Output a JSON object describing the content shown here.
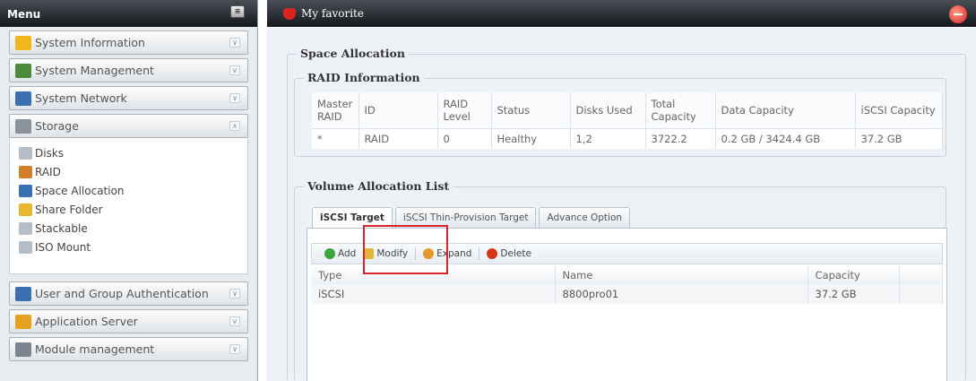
{
  "menu": {
    "title": "Menu",
    "groups_top": [
      {
        "label": "System Information",
        "icon": "info-icon",
        "color": "#f2b51c"
      },
      {
        "label": "System Management",
        "icon": "tools-icon",
        "color": "#4a8a3a"
      },
      {
        "label": "System Network",
        "icon": "network-icon",
        "color": "#3a6fb0"
      },
      {
        "label": "Storage",
        "icon": "storage-icon",
        "color": "#8a939c"
      }
    ],
    "storage_items": [
      {
        "label": "Disks",
        "icon": "disk-icon",
        "color": "#b5bec6"
      },
      {
        "label": "RAID",
        "icon": "raid-icon",
        "color": "#d0802a"
      },
      {
        "label": "Space Allocation",
        "icon": "space-allocation-icon",
        "color": "#3a6fb0"
      },
      {
        "label": "Share Folder",
        "icon": "folder-icon",
        "color": "#e8b730"
      },
      {
        "label": "Stackable",
        "icon": "stackable-icon",
        "color": "#b5bec6"
      },
      {
        "label": "ISO Mount",
        "icon": "iso-icon",
        "color": "#b5bec6"
      }
    ],
    "groups_bottom": [
      {
        "label": "User and Group Authentication",
        "icon": "users-icon",
        "color": "#3a6fb0"
      },
      {
        "label": "Application Server",
        "icon": "app-server-icon",
        "color": "#e8a020"
      },
      {
        "label": "Module management",
        "icon": "module-icon",
        "color": "#7a8590"
      }
    ]
  },
  "favorite": {
    "label": "My favorite"
  },
  "space_allocation": {
    "legend": "Space Allocation",
    "raid_info_legend": "RAID Information",
    "raid_columns": [
      "Master RAID",
      "ID",
      "RAID Level",
      "Status",
      "Disks Used",
      "Total Capacity",
      "Data Capacity",
      "iSCSI Capacity"
    ],
    "raid_rows": [
      [
        "*",
        "RAID",
        "0",
        "Healthy",
        "1,2",
        "3722.2",
        "0.2 GB / 3424.4 GB",
        "37.2 GB"
      ]
    ],
    "volume_legend": "Volume Allocation List",
    "tabs": [
      "iSCSI Target",
      "iSCSI Thin-Provision Target",
      "Advance Option"
    ],
    "toolbar": {
      "add": "Add",
      "modify": "Modify",
      "expand": "Expand",
      "delete": "Delete"
    },
    "volume_columns": [
      "Type",
      "Name",
      "Capacity"
    ],
    "volume_rows": [
      [
        "iSCSI",
        "8800pro01",
        "37.2 GB"
      ]
    ]
  }
}
